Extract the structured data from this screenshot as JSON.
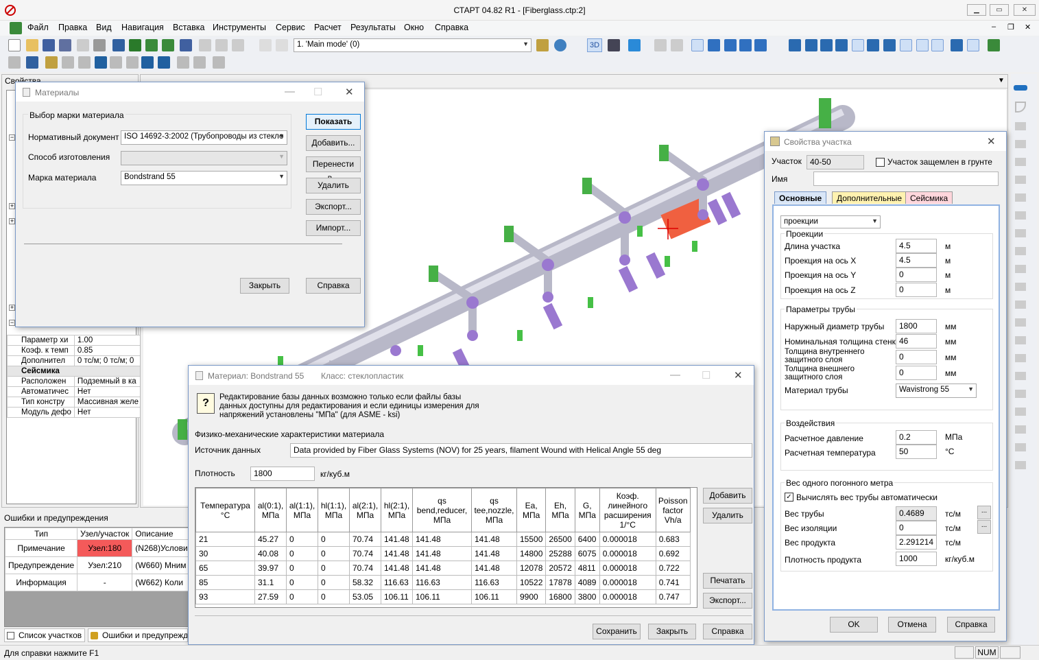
{
  "window": {
    "title": "СТАРТ 04.82 R1 - [Fiberglass.ctp:2]"
  },
  "menu": [
    "Файл",
    "Правка",
    "Вид",
    "Навигация",
    "Вставка",
    "Инструменты",
    "Сервис",
    "Расчет",
    "Результаты",
    "Окно",
    "Справка"
  ],
  "toolbar": {
    "mode_combo": "1. 'Main mode' (0)",
    "view3d": "3D"
  },
  "left_panel": {
    "title": "Свойства",
    "props": [
      {
        "name": "Параметр хи",
        "value": "1.00"
      },
      {
        "name": "Коэф. к темп",
        "value": "0.85"
      },
      {
        "name": "Дополнител",
        "value": "0 тс/м; 0 тс/м; 0"
      }
    ],
    "section_seismic": "Сейсмика",
    "seismic_props": [
      {
        "name": "Расположен",
        "value": "Подземный в ка"
      },
      {
        "name": "Автоматичес",
        "value": "Нет"
      },
      {
        "name": "Тип констру",
        "value": "Массивная желе"
      },
      {
        "name": "Модуль дефо",
        "value": "Нет"
      }
    ]
  },
  "errors_panel": {
    "title": "Ошибки и предупреждения",
    "headers": [
      "Тип",
      "Узел/участок",
      "Описание"
    ],
    "rows": [
      {
        "type": "Примечание",
        "node": "Узел:180",
        "desc": "(N268)Услови"
      },
      {
        "type": "Предупреждение",
        "node": "Узел:210",
        "desc": "(W660) Мним"
      },
      {
        "type": "Информация",
        "node": "-",
        "desc": "(W662) Коли"
      }
    ],
    "tabs": [
      "Список участков",
      "Ошибки и предупрежд"
    ]
  },
  "materials_dialog": {
    "title": "Материалы",
    "group": "Выбор марки материала",
    "doc_label": "Нормативный документ",
    "doc_value": "ISO 14692-3:2002 (Трубопроводы из стекло",
    "method_label": "Способ изготовления",
    "method_value": "",
    "grade_label": "Марка материала",
    "grade_value": "Bondstrand 55",
    "buttons": [
      "Показать",
      "Добавить...",
      "Перенести в...",
      "Удалить",
      "Экспорт...",
      "Импорт..."
    ],
    "close": "Закрыть",
    "help": "Справка"
  },
  "material_dialog": {
    "title": "Материал: Bondstrand 55",
    "class": "Класс: стеклопластик",
    "note": "Редактирование базы данных возможно только если файлы базы данных доступны для редактирования и если единицы измерения для напряжений установлены \"МПа\" (для ASME - ksi)",
    "section": "Физико-механические характеристики материала",
    "source_label": "Источник данных",
    "source_value": "Data provided by Fiber Glass Systems (NOV) for 25 years, filament Wound with Helical Angle 55 deg",
    "density_label": "Плотность",
    "density_value": "1800",
    "density_unit": "кг/куб.м",
    "headers": [
      "Температура °С",
      "al(0:1), МПа",
      "al(1:1), МПа",
      "hl(1:1), МПа",
      "al(2:1), МПа",
      "hl(2:1), МПа",
      "qs bend,reducer, МПа",
      "qs tee,nozzle, МПа",
      "Ea, МПа",
      "Eh, МПа",
      "G, МПа",
      "Коэф. линейного расширения 1/°С",
      "Poisson factor Vh/a"
    ],
    "rows": [
      [
        "21",
        "45.27",
        "0",
        "0",
        "70.74",
        "141.48",
        "141.48",
        "141.48",
        "15500",
        "26500",
        "6400",
        "0.000018",
        "0.683"
      ],
      [
        "30",
        "40.08",
        "0",
        "0",
        "70.74",
        "141.48",
        "141.48",
        "141.48",
        "14800",
        "25288",
        "6075",
        "0.000018",
        "0.692"
      ],
      [
        "65",
        "39.97",
        "0",
        "0",
        "70.74",
        "141.48",
        "141.48",
        "141.48",
        "12078",
        "20572",
        "4811",
        "0.000018",
        "0.722"
      ],
      [
        "85",
        "31.1",
        "0",
        "0",
        "58.32",
        "116.63",
        "116.63",
        "116.63",
        "10522",
        "17878",
        "4089",
        "0.000018",
        "0.741"
      ],
      [
        "93",
        "27.59",
        "0",
        "0",
        "53.05",
        "106.11",
        "106.11",
        "106.11",
        "9900",
        "16800",
        "3800",
        "0.000018",
        "0.747"
      ]
    ],
    "side_buttons": [
      "Добавить",
      "Удалить",
      "Печатать",
      "Экспорт..."
    ],
    "bottom_buttons": [
      "Сохранить",
      "Закрыть",
      "Справка"
    ]
  },
  "segment_dialog": {
    "title": "Свойства участка",
    "segment_label": "Участок",
    "segment_value": "40-50",
    "buried_label": "Участок защемлен в грунте",
    "name_label": "Имя",
    "name_value": "",
    "tabs": [
      "Основные",
      "Дополнительные",
      "Сейсмика"
    ],
    "mode": "проекции",
    "proj_group": "Проекции",
    "proj": [
      {
        "label": "Длина участка",
        "value": "4.5",
        "unit": "м"
      },
      {
        "label": "Проекция на ось X",
        "value": "4.5",
        "unit": "м"
      },
      {
        "label": "Проекция на ось Y",
        "value": "0",
        "unit": "м"
      },
      {
        "label": "Проекция на ось Z",
        "value": "0",
        "unit": "м"
      }
    ],
    "pipe_group": "Параметры трубы",
    "pipe": [
      {
        "label": "Наружный диаметр трубы",
        "value": "1800",
        "unit": "мм"
      },
      {
        "label": "Номинальная толщина стенки",
        "value": "46",
        "unit": "мм"
      },
      {
        "label": "Толщина внутреннего защитного слоя",
        "value": "0",
        "unit": "мм"
      },
      {
        "label": "Толщина внешнего защитного слоя",
        "value": "0",
        "unit": "мм"
      }
    ],
    "material_label": "Материал трубы",
    "material_value": "Wavistrong 55",
    "loads_group": "Воздействия",
    "loads": [
      {
        "label": "Расчетное давление",
        "value": "0.2",
        "unit": "МПа"
      },
      {
        "label": "Расчетная температура",
        "value": "50",
        "unit": "°С"
      }
    ],
    "weight_group": "Вес одного погонного метра",
    "auto_weight": "Вычислять вес трубы автоматически",
    "weights": [
      {
        "label": "Вес трубы",
        "value": "0.4689",
        "unit": "тс/м"
      },
      {
        "label": "Вес изоляции",
        "value": "0",
        "unit": "тс/м"
      },
      {
        "label": "Вес продукта",
        "value": "2.291214",
        "unit": "тс/м"
      },
      {
        "label": "Плотность продукта",
        "value": "1000",
        "unit": "кг/куб.м"
      }
    ],
    "buttons": [
      "OK",
      "Отмена",
      "Справка"
    ]
  },
  "status": {
    "help": "Для справки нажмите F1",
    "num": "NUM"
  }
}
